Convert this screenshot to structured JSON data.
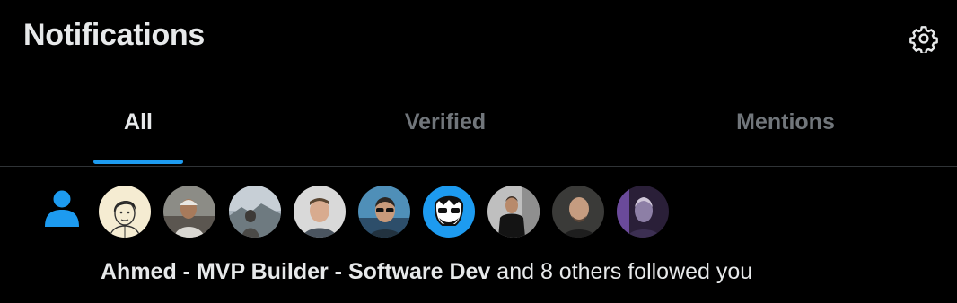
{
  "header": {
    "title": "Notifications",
    "settings_icon": "gear-icon"
  },
  "tabs": [
    {
      "label": "All",
      "active": true
    },
    {
      "label": "Verified",
      "active": false
    },
    {
      "label": "Mentions",
      "active": false
    }
  ],
  "notification": {
    "type_icon": "person-icon",
    "avatars": [
      {
        "name": "avatar-1",
        "desc": "sketch portrait"
      },
      {
        "name": "avatar-2",
        "desc": "man with cap"
      },
      {
        "name": "avatar-3",
        "desc": "landscape"
      },
      {
        "name": "avatar-4",
        "desc": "man portrait"
      },
      {
        "name": "avatar-5",
        "desc": "man with sunglasses"
      },
      {
        "name": "avatar-6",
        "desc": "cartoon avatar"
      },
      {
        "name": "avatar-7",
        "desc": "man standing"
      },
      {
        "name": "avatar-8",
        "desc": "bald man"
      },
      {
        "name": "avatar-9",
        "desc": "man purple light"
      }
    ],
    "actor_name": "Ahmed - MVP Builder - Software Dev",
    "action_text": " and 8 others followed you"
  },
  "colors": {
    "background": "#000000",
    "text_primary": "#e7e9ea",
    "text_secondary": "#71767b",
    "accent": "#1d9bf0",
    "divider": "#2f3336"
  }
}
